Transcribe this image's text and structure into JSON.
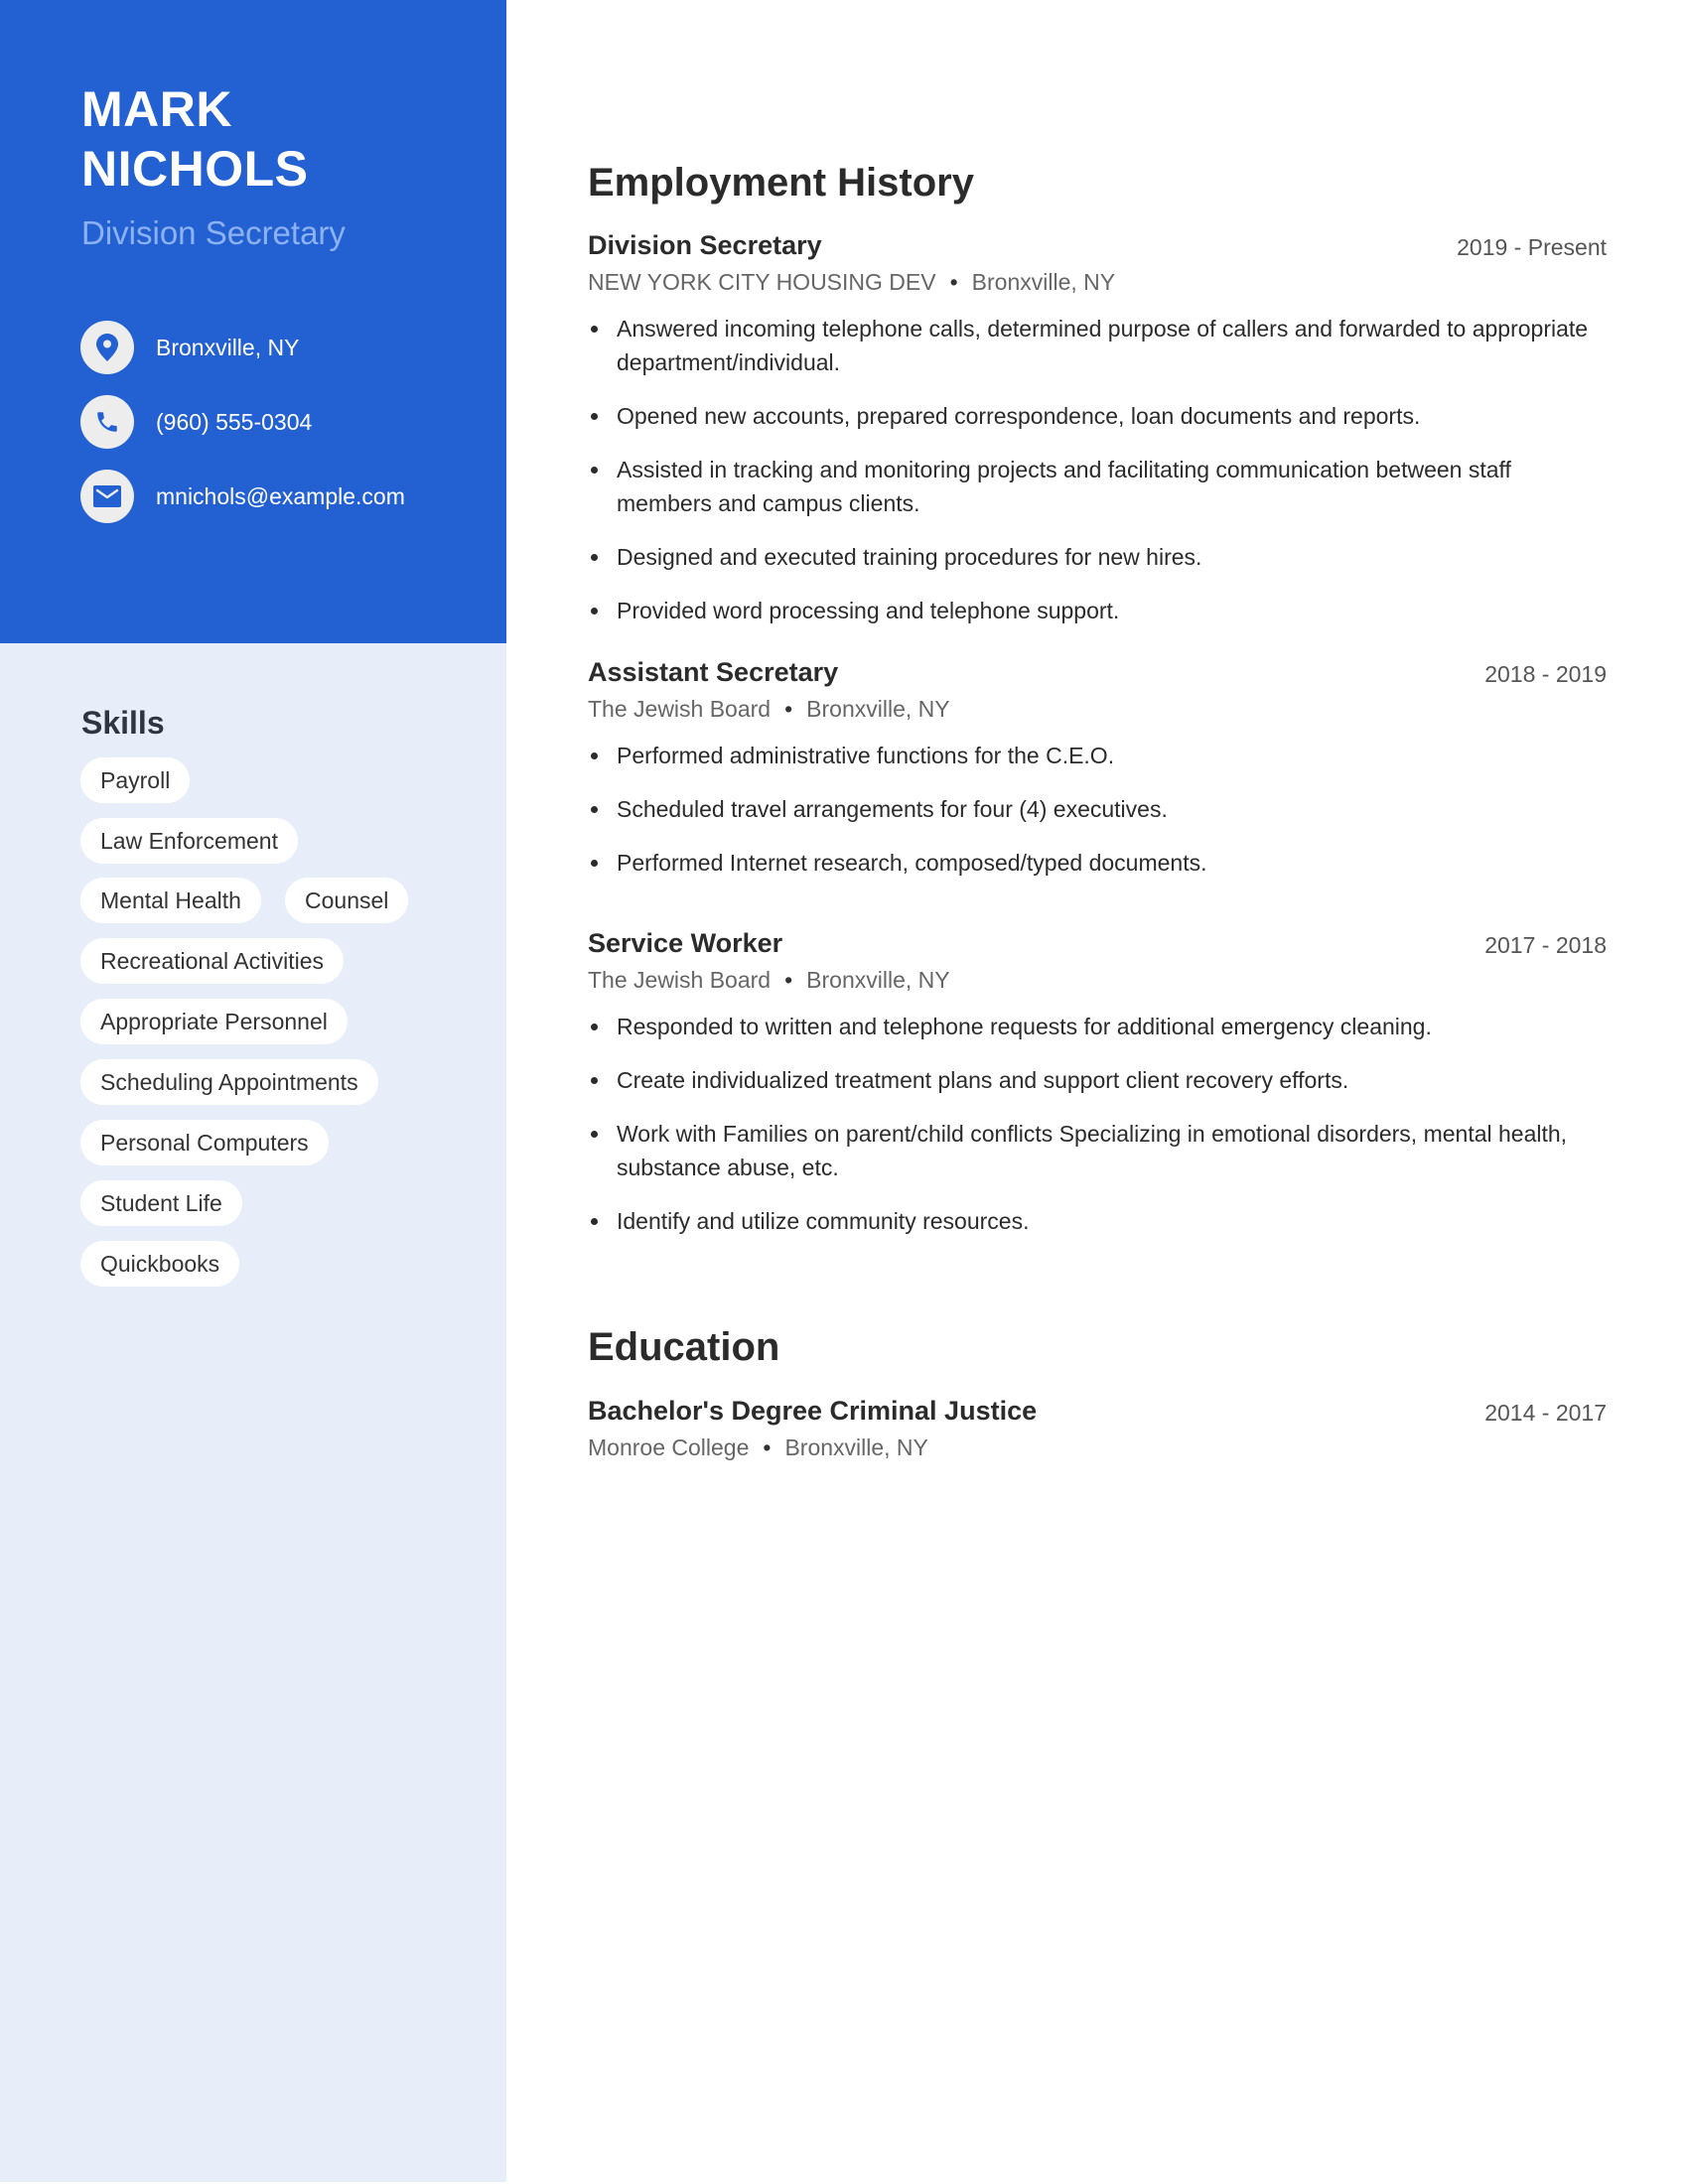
{
  "profile": {
    "first_name": "MARK",
    "last_name": "NICHOLS",
    "title": "Division Secretary"
  },
  "contact": {
    "location": {
      "icon": "location-pin-icon",
      "text": "Bronxville, NY"
    },
    "phone": {
      "icon": "phone-icon",
      "text": "(960) 555-0304"
    },
    "email": {
      "icon": "envelope-icon",
      "text": "mnichols@example.com"
    }
  },
  "skills": {
    "title": "Skills",
    "items": [
      "Payroll",
      "Law Enforcement",
      "Mental Health",
      "Counsel",
      "Recreational Activities",
      "Appropriate Personnel",
      "Scheduling Appointments",
      "Personal Computers",
      "Student Life",
      "Quickbooks"
    ]
  },
  "employment": {
    "title": "Employment History",
    "jobs": [
      {
        "title": "Division Secretary",
        "dates": "2019 - Present",
        "company": "NEW YORK CITY HOUSING DEV",
        "location": "Bronxville, NY",
        "bullets": [
          "Answered incoming telephone calls, determined purpose of callers and forwarded to appropriate department/individual.",
          "Opened new accounts, prepared correspondence, loan documents and reports.",
          "Assisted in tracking and monitoring projects and facilitating communication between staff members and campus clients.",
          "Designed and executed training procedures for new hires.",
          "Provided word processing and telephone support."
        ]
      },
      {
        "title": "Assistant Secretary",
        "dates": "2018 - 2019",
        "company": "The Jewish Board",
        "location": "Bronxville, NY",
        "bullets": [
          "Performed administrative functions for the C.E.O.",
          "Scheduled travel arrangements for four (4) executives.",
          "Performed Internet research, composed/typed documents."
        ]
      },
      {
        "title": "Service Worker",
        "dates": "2017 - 2018",
        "company": "The Jewish Board",
        "location": "Bronxville, NY",
        "bullets": [
          "Responded to written and telephone requests for additional emergency cleaning.",
          "Create individualized treatment plans and support client recovery efforts.",
          "Work with Families on parent/child conflicts Specializing in emotional disorders, mental health, substance abuse, etc.",
          "Identify and utilize community resources."
        ]
      }
    ]
  },
  "education": {
    "title": "Education",
    "items": [
      {
        "degree": "Bachelor's Degree Criminal Justice",
        "dates": "2014 - 2017",
        "school": "Monroe College",
        "location": "Bronxville, NY"
      }
    ]
  },
  "colors": {
    "accent": "#2361d3",
    "sidebar_light": "#e7eef9",
    "subtitle": "#8db2f2"
  }
}
